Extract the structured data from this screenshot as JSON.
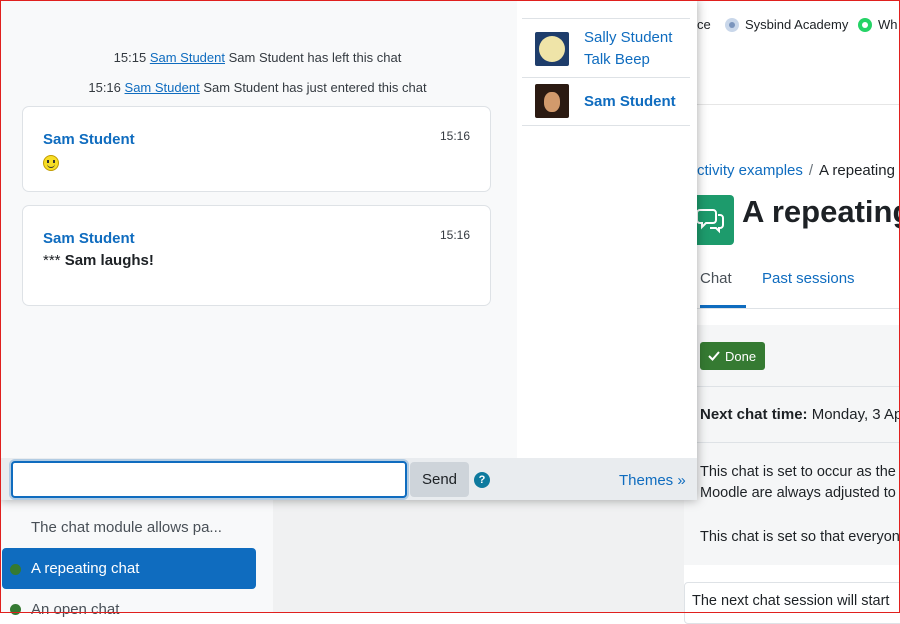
{
  "bookmarks": [
    {
      "label": "ce",
      "icon": "none"
    },
    {
      "label": "Sysbind Academy",
      "icon": "academy-icon"
    },
    {
      "label": "Wh",
      "icon": "whatsapp-icon"
    }
  ],
  "breadcrumb": {
    "item1": "ctivity examples",
    "separator": "/",
    "item2": "A repeating"
  },
  "page": {
    "title": "A repeating",
    "tabs": [
      "Chat",
      "Past sessions"
    ],
    "done_label": "Done",
    "next_chat_label": "Next chat time:",
    "next_chat_value": "Monday, 3 Ap",
    "desc_line1": "This chat is set to occur as the",
    "desc_line2": "Moodle are always adjusted to",
    "desc_line3": "This chat is set so that everyon",
    "next_session_text": "The next chat session will start"
  },
  "course_index": {
    "description": "The chat module allows pa...",
    "active_item": "A repeating chat",
    "next_item": "An open chat"
  },
  "chat": {
    "system_messages": [
      {
        "time": "15:15",
        "user": "Sam Student",
        "text": "Sam Student has left this chat"
      },
      {
        "time": "15:16",
        "user": "Sam Student",
        "text": "Sam Student has just entered this chat"
      }
    ],
    "messages": [
      {
        "user": "Sam Student",
        "time": "15:16",
        "text": "",
        "emoji": "smiley"
      },
      {
        "user": "Sam Student",
        "time": "15:16",
        "prefix": "***",
        "text": "Sam laughs!"
      }
    ],
    "users": [
      {
        "line1": "Sally Student",
        "line2": "Talk Beep"
      },
      {
        "line1": "Sam Student"
      }
    ],
    "input_value": "",
    "send_label": "Send",
    "help_glyph": "?",
    "themes_label": "Themes »"
  },
  "colors": {
    "link": "#0f6cbf",
    "done": "#357a32",
    "chat_icon": "#1d9b6c",
    "frame": "#e0201e"
  }
}
